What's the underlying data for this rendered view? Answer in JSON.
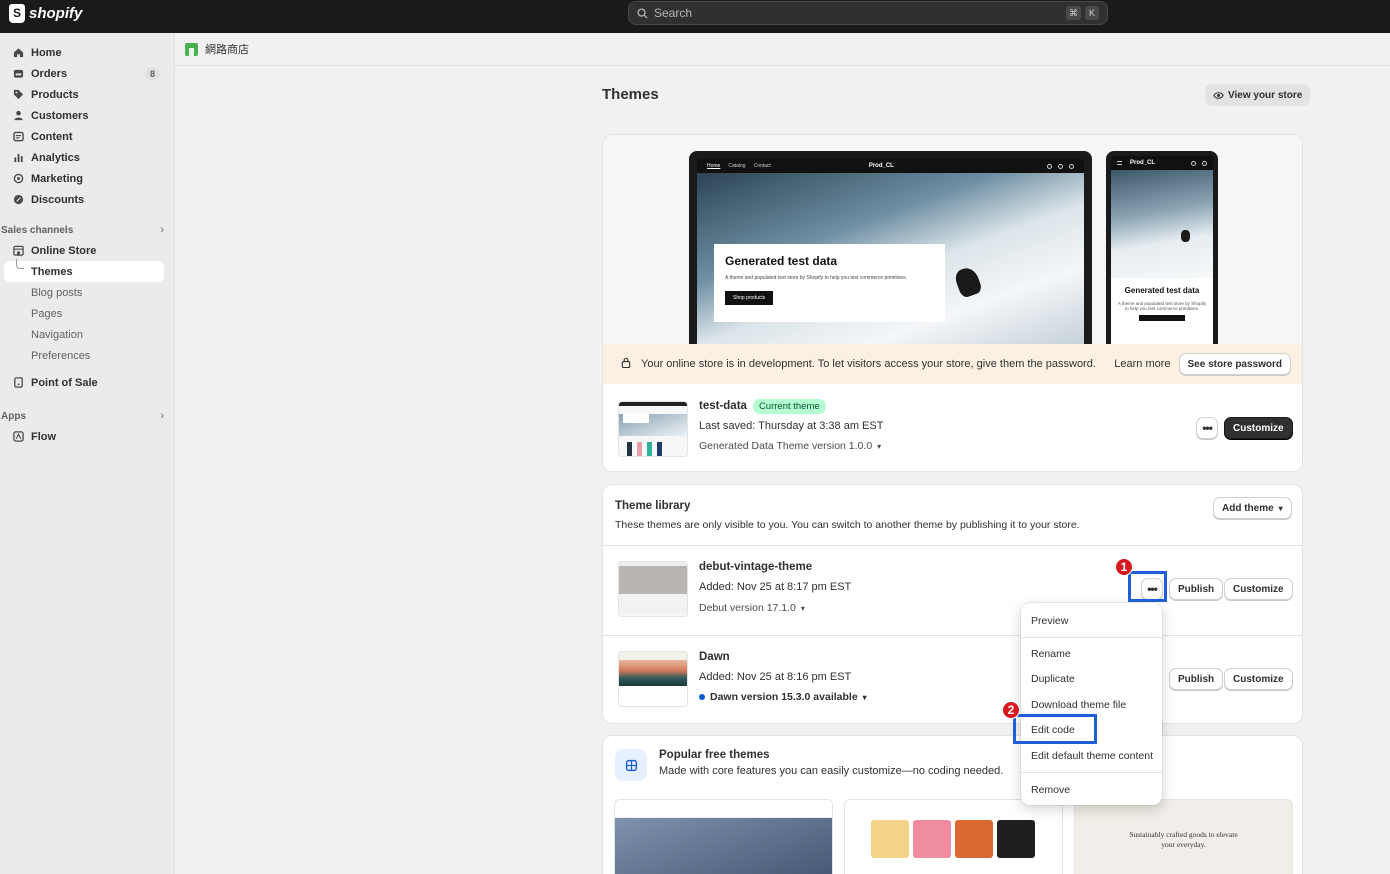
{
  "topbar": {
    "logo_text": "shopify",
    "search_placeholder": "Search",
    "shortcut_keys": [
      "⌘",
      "K"
    ]
  },
  "sidebar": {
    "items": [
      {
        "label": "Home",
        "icon": "home-icon"
      },
      {
        "label": "Orders",
        "icon": "orders-icon",
        "badge": "8"
      },
      {
        "label": "Products",
        "icon": "tag-icon"
      },
      {
        "label": "Customers",
        "icon": "person-icon"
      },
      {
        "label": "Content",
        "icon": "content-icon"
      },
      {
        "label": "Analytics",
        "icon": "bar-chart-icon"
      },
      {
        "label": "Marketing",
        "icon": "target-icon"
      },
      {
        "label": "Discounts",
        "icon": "discount-icon"
      }
    ],
    "sales_channels_label": "Sales channels",
    "online_store_label": "Online Store",
    "online_store_sub": [
      "Themes",
      "Blog posts",
      "Pages",
      "Navigation",
      "Preferences"
    ],
    "point_of_sale_label": "Point of Sale",
    "apps_label": "Apps",
    "flow_label": "Flow"
  },
  "breadcrumb": {
    "store_name": "網路商店"
  },
  "page": {
    "title": "Themes",
    "view_store_label": "View your store"
  },
  "preview": {
    "laptop_nav": [
      "Home",
      "Catalog",
      "Contact"
    ],
    "store_brand": "Prod_CL",
    "hero_title": "Generated test data",
    "hero_text": "A theme and populated test store by Shopify to help you test commerce primitives.",
    "hero_button": "Shop products",
    "phone_title": "Generated test data",
    "phone_text": "A theme and populated test store by Shopify to help you test commerce primitives."
  },
  "dev_banner": {
    "message": "Your online store is in development. To let visitors access your store, give them the password.",
    "learn_more": "Learn more",
    "see_password": "See store password"
  },
  "current_theme": {
    "name": "test-data",
    "badge": "Current theme",
    "saved": "Last saved: Thursday at 3:38 am EST",
    "version": "Generated Data Theme version 1.0.0",
    "more_label": "•••",
    "customize_label": "Customize"
  },
  "library": {
    "title": "Theme library",
    "subtitle": "These themes are only visible to you. You can switch to another theme by publishing it to your store.",
    "add_theme_label": "Add theme",
    "themes": [
      {
        "name": "debut-vintage-theme",
        "added": "Added: Nov 25 at 8:17 pm EST",
        "version": "Debut version 17.1.0",
        "publish": "Publish",
        "customize": "Customize",
        "more": "•••"
      },
      {
        "name": "Dawn",
        "added": "Added: Nov 25 at 8:16 pm EST",
        "version": "Dawn version 15.3.0 available",
        "publish": "Publish",
        "customize": "Customize",
        "more": "•••"
      }
    ]
  },
  "menu": {
    "items": [
      "Preview",
      "Rename",
      "Duplicate",
      "Download theme file",
      "Edit code",
      "Edit default theme content",
      "Remove"
    ]
  },
  "popular": {
    "title": "Popular free themes",
    "subtitle": "Made with core features you can easily customize—no coding needed.",
    "third_thumb_text": "Sustainably crafted goods to elevate your everyday."
  },
  "annotations": {
    "step1": "1",
    "step2": "2",
    "highlight_color": "#1f5fd6",
    "badge_color": "#d71920"
  },
  "colors": {
    "topbar": "#1a1a1a",
    "sidebar": "#ebebeb",
    "current_badge_bg": "#b4fed2",
    "dev_banner_bg": "#fcf0e3",
    "update_dot": "#005bd3"
  }
}
